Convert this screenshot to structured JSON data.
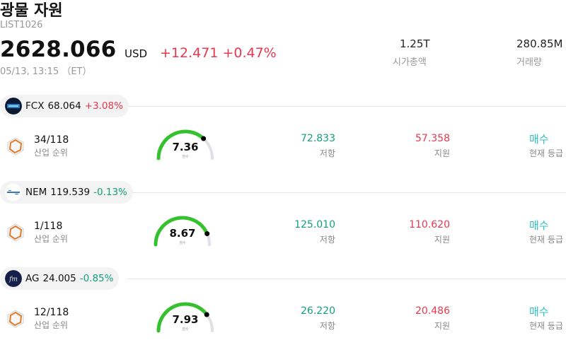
{
  "header": {
    "title": "광물 자원",
    "code": "LIST1026",
    "price": "2628.066",
    "currency": "USD",
    "change": "+12.471 +0.47%",
    "datetime": "05/13, 13:15 （ET）",
    "market_cap_value": "1.25T",
    "market_cap_label": "시가총액",
    "volume_value": "280.85M",
    "volume_label": "거래량"
  },
  "colors": {
    "up": "#e8384f",
    "down": "#13a07c",
    "buy": "#2fc0c0",
    "gauge": "#35c12e"
  },
  "stocks": [
    {
      "ticker": "FCX",
      "price": "68.064",
      "change": "+3.08%",
      "direction": "up",
      "logo": "fcx-logo",
      "rank": "34/118",
      "rank_label": "산업 순위",
      "score": "7.36",
      "score_fraction": 0.736,
      "score_caption": "점수",
      "resistance": "72.833",
      "resistance_label": "저항",
      "support": "57.358",
      "support_label": "지원",
      "rating": "매수",
      "rating_label": "현재 등급"
    },
    {
      "ticker": "NEM",
      "price": "119.539",
      "change": "-0.13%",
      "direction": "down",
      "logo": "nem-logo",
      "rank": "1/118",
      "rank_label": "산업 순위",
      "score": "8.67",
      "score_fraction": 0.867,
      "score_caption": "점수",
      "resistance": "125.010",
      "resistance_label": "저항",
      "support": "110.620",
      "support_label": "지원",
      "rating": "매수",
      "rating_label": "현재 등급"
    },
    {
      "ticker": "AG",
      "price": "24.005",
      "change": "-0.85%",
      "direction": "down",
      "logo": "ag-logo",
      "rank": "12/118",
      "rank_label": "산업 순위",
      "score": "7.93",
      "score_fraction": 0.793,
      "score_caption": "점수",
      "resistance": "26.220",
      "resistance_label": "저항",
      "support": "20.486",
      "support_label": "지원",
      "rating": "매수",
      "rating_label": "현재 등급"
    }
  ]
}
